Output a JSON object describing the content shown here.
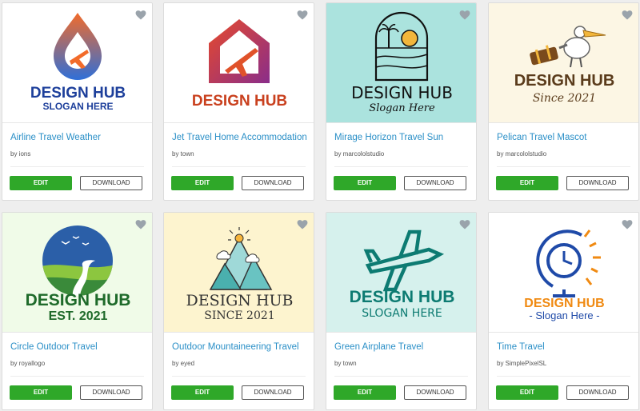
{
  "cards": [
    {
      "logo": {
        "line1": "DESIGN HUB",
        "line2": "SLOGAN HERE",
        "bg": "#ffffff",
        "color1": "#1d3f9b",
        "color2": "#1d3f9b",
        "icon": "drop-airplane-icon"
      },
      "title": "Airline Travel Weather",
      "author": "by ions",
      "edit": "EDIT",
      "download": "DOWNLOAD",
      "favorite_icon": "heart-icon"
    },
    {
      "logo": {
        "line1": "DESIGN HUB",
        "line2": "",
        "bg": "#ffffff",
        "color1": "#c9401e",
        "color2": "#c9401e",
        "icon": "house-airplane-icon"
      },
      "title": "Jet Travel Home Accommodation",
      "author": "by town",
      "edit": "EDIT",
      "download": "DOWNLOAD",
      "favorite_icon": "heart-icon"
    },
    {
      "logo": {
        "line1": "DESIGN HUB",
        "line2": "Slogan Here",
        "bg": "#abe3de",
        "color1": "#111111",
        "color2": "#111111",
        "icon": "arch-sunset-beach-icon"
      },
      "title": "Mirage Horizon Travel Sun",
      "author": "by marcololstudio",
      "edit": "EDIT",
      "download": "DOWNLOAD",
      "favorite_icon": "heart-icon"
    },
    {
      "logo": {
        "line1": "DESIGN HUB",
        "line2": "Since 2021",
        "bg": "#fcf6e4",
        "color1": "#5a3b1b",
        "color2": "#5a3b1b",
        "icon": "pelican-suitcase-icon"
      },
      "title": "Pelican Travel Mascot",
      "author": "by marcololstudio",
      "edit": "EDIT",
      "download": "DOWNLOAD",
      "favorite_icon": "heart-icon"
    },
    {
      "logo": {
        "line1": "DESIGN HUB",
        "line2": "EST. 2021",
        "bg": "#f0fbe8",
        "color1": "#1e6a2a",
        "color2": "#1e6a2a",
        "icon": "circle-road-landscape-icon"
      },
      "title": "Circle Outdoor Travel",
      "author": "by royallogo",
      "edit": "EDIT",
      "download": "DOWNLOAD",
      "favorite_icon": "heart-icon"
    },
    {
      "logo": {
        "line1": "DESIGN HUB",
        "line2": "SINCE 2021",
        "bg": "#fdf4cf",
        "color1": "#333333",
        "color2": "#333333",
        "icon": "mountain-sun-icon"
      },
      "title": "Outdoor Mountaineering Travel",
      "author": "by eyed",
      "edit": "EDIT",
      "download": "DOWNLOAD",
      "favorite_icon": "heart-icon"
    },
    {
      "logo": {
        "line1": "DESIGN HUB",
        "line2": "SLOGAN HERE",
        "bg": "#d6f1ed",
        "color1": "#0d7b72",
        "color2": "#0d7b72",
        "icon": "outline-airplane-icon"
      },
      "title": "Green Airplane Travel",
      "author": "by town",
      "edit": "EDIT",
      "download": "DOWNLOAD",
      "favorite_icon": "heart-icon"
    },
    {
      "logo": {
        "line1": "DESIGN HUB",
        "line2": "- Slogan Here -",
        "bg": "#ffffff",
        "color1": "#f08a12",
        "color2": "#1f4aa8",
        "icon": "globe-clock-icon"
      },
      "title": "Time Travel",
      "author": "by SimplePixelSL",
      "edit": "EDIT",
      "download": "DOWNLOAD",
      "favorite_icon": "heart-icon"
    }
  ]
}
